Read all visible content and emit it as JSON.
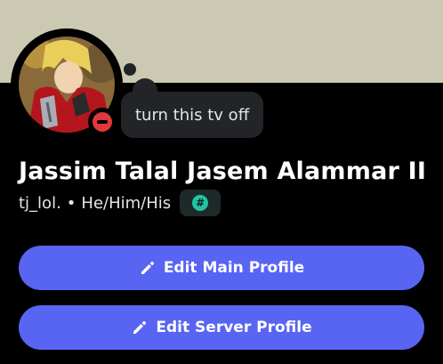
{
  "banner": {
    "color": "#cbc9b1"
  },
  "avatar": {
    "status": "do-not-disturb",
    "status_color": "#e0383e"
  },
  "custom_status": {
    "text": "turn this tv off"
  },
  "profile": {
    "display_name": "Jassim Talal Jasem Alammar II",
    "username": "tj_lol.",
    "separator": "•",
    "pronouns": "He/Him/His",
    "badge_icon": "#"
  },
  "buttons": {
    "edit_main": {
      "label": "Edit Main Profile",
      "icon": "pencil-icon"
    },
    "edit_server": {
      "label": "Edit Server Profile",
      "icon": "pencil-icon"
    }
  },
  "colors": {
    "accent": "#5865f2",
    "background": "#000000",
    "badge": "#21c4a3"
  }
}
